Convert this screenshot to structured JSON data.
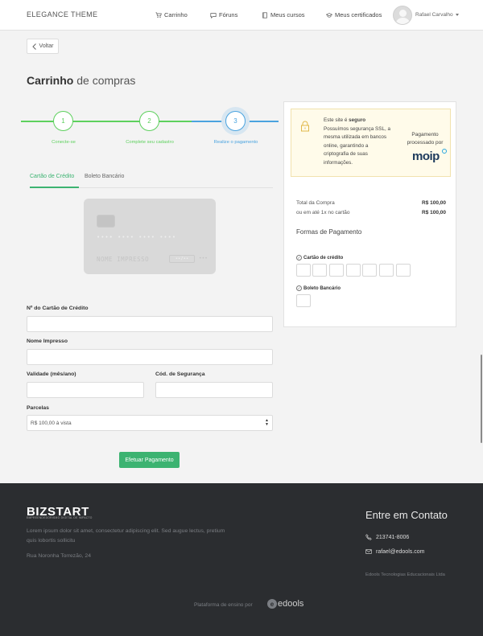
{
  "header": {
    "brand": "ELEGANCE THEME",
    "nav": [
      {
        "label": "Carrinho",
        "icon": "cart-icon"
      },
      {
        "label": "Fóruns",
        "icon": "chat-bubble-icon"
      },
      {
        "label": "Meus cursos",
        "icon": "book-icon"
      },
      {
        "label": "Meus certificados",
        "icon": "graduation-cap-icon"
      }
    ],
    "user_name": "Rafael Carvalho"
  },
  "back_label": "Voltar",
  "title": {
    "bold": "Carrinho",
    "rest": "de compras"
  },
  "steps": [
    {
      "number": "1",
      "label": "Conecte-se",
      "state": "done"
    },
    {
      "number": "2",
      "label": "Complete seu cadastro",
      "state": "done"
    },
    {
      "number": "3",
      "label": "Realize o pagamento",
      "state": "active"
    }
  ],
  "colors": {
    "green": "#3cb371",
    "step_done": "#5dd05d",
    "step_active": "#4aa3df",
    "footer_bg": "#2b2d30"
  },
  "tabs": [
    {
      "label": "Cartão de Crédito",
      "active": true
    },
    {
      "label": "Boleto Bancário",
      "active": false
    }
  ],
  "card_preview": {
    "number": "•••• •••• •••• ••••",
    "name": "NOME IMPRESSO",
    "expiry": "••/••",
    "cvv": "•••"
  },
  "form": {
    "card_number_label": "Nº do Cartão de Crédito",
    "name_label": "Nome Impresso",
    "validity_label": "Validade (mês/ano)",
    "security_label": "Cód. de Segurança",
    "installments_label": "Parcelas",
    "installments_value": "R$ 100,00 à vista",
    "submit_label": "Efetuar Pagamento"
  },
  "side": {
    "secure_prefix": "Este site é ",
    "secure_bold": "seguro",
    "secure_rest": "Possuímos segurança SSL, a mesma utilizada em bancos online, garantindo a criptografia de suas informações.",
    "processed_by": "Pagamento processado por",
    "moip_logo": "moip",
    "total_label": "Total da Compra",
    "total_value": "R$ 100,00",
    "installment_label": "ou em até 1x no cartão",
    "installment_value": "R$ 100,00",
    "methods_title": "Formas de Pagamento",
    "method_card": "Cartão de crédito",
    "method_boleto": "Boleto Bancário"
  },
  "footer": {
    "logo": "BIZSTART",
    "tagline": "EMPREENDEDORISMO DIGITAL DE IMPACTO",
    "description": "Lorem ipsum dolor sit amet, consectetur adipiscing elit. Sed augue lectus, pretium quis lobortis sollicitu",
    "address": "Rua Noronha Torrezão, 24",
    "contact_title": "Entre em Contato",
    "phone": "213741-8006",
    "email": "rafael@edools.com",
    "company": "Edools Tecnologias Educacionais Ltda",
    "platform_text": "Plataforma de ensino por",
    "edools_logo": "edools"
  }
}
